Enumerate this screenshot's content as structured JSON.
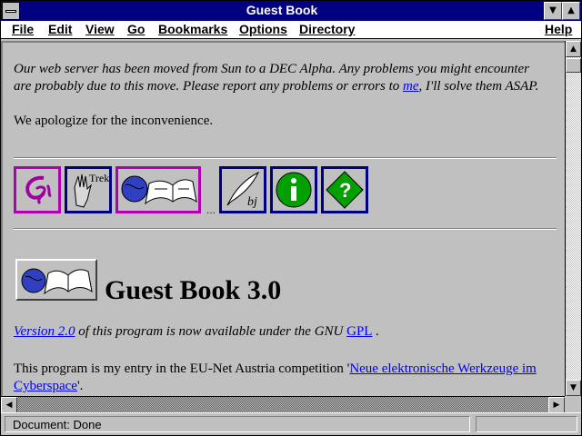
{
  "window": {
    "title": "Guest Book"
  },
  "menu": {
    "file": "File",
    "edit": "Edit",
    "view": "View",
    "go": "Go",
    "bookmarks": "Bookmarks",
    "options": "Options",
    "directory": "Directory",
    "help": "Help"
  },
  "content": {
    "notice_part1": "Our web server has been moved from Sun to a DEC Alpha. Any problems you might encounter are probably due to this move. Please report any problems or errors to ",
    "notice_link": "me",
    "notice_part2": ", I'll solve them ASAP.",
    "apology": "We apologize for the inconvenience.",
    "toolbar_icons": [
      "cgi-icon",
      "star-trek-hand-icon",
      "globe-book-icon",
      "quill-icon",
      "info-icon",
      "question-icon"
    ],
    "trek_label": "Trek",
    "heading": "Guest Book 3.0",
    "version_link": "Version 2.0",
    "version_text": " of this program is now available under the GNU ",
    "gpl_link": "GPL",
    "version_end": " .",
    "entry_text": "This program is my entry in the EU-Net Austria competition '",
    "entry_link": "Neue elektronische Werkzeuge im Cyberspace",
    "entry_end": "'."
  },
  "status": {
    "text": "Document: Done"
  },
  "colors": {
    "title_bar": "#000080",
    "link": "#0000ee",
    "icon_border": "#000080",
    "icon_border_alt": "#b000b0",
    "scroll_teal": "#008080"
  }
}
